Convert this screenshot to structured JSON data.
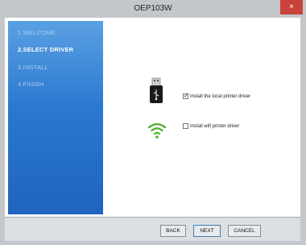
{
  "window": {
    "title": "OEP103W",
    "close_glyph": "×"
  },
  "steps": [
    {
      "label": "1.WELCOME",
      "state": "done"
    },
    {
      "label": "2.SELECT DRIVER",
      "state": "active"
    },
    {
      "label": "3.INSTALL",
      "state": "pending"
    },
    {
      "label": "4.FINISH",
      "state": "pending"
    }
  ],
  "options": [
    {
      "icon": "usb-drive-icon",
      "label": "Install the local printer driver",
      "checked": true
    },
    {
      "icon": "wifi-icon",
      "label": "Install wifi printer driver",
      "checked": false
    }
  ],
  "buttons": {
    "back": "BACK",
    "next": "NEXT",
    "cancel": "CANCEL"
  },
  "colors": {
    "sidebar_top": "#5aa0e3",
    "sidebar_bottom": "#1f64bf",
    "wifi_green": "#4cae2a",
    "close_red": "#c9423b"
  }
}
